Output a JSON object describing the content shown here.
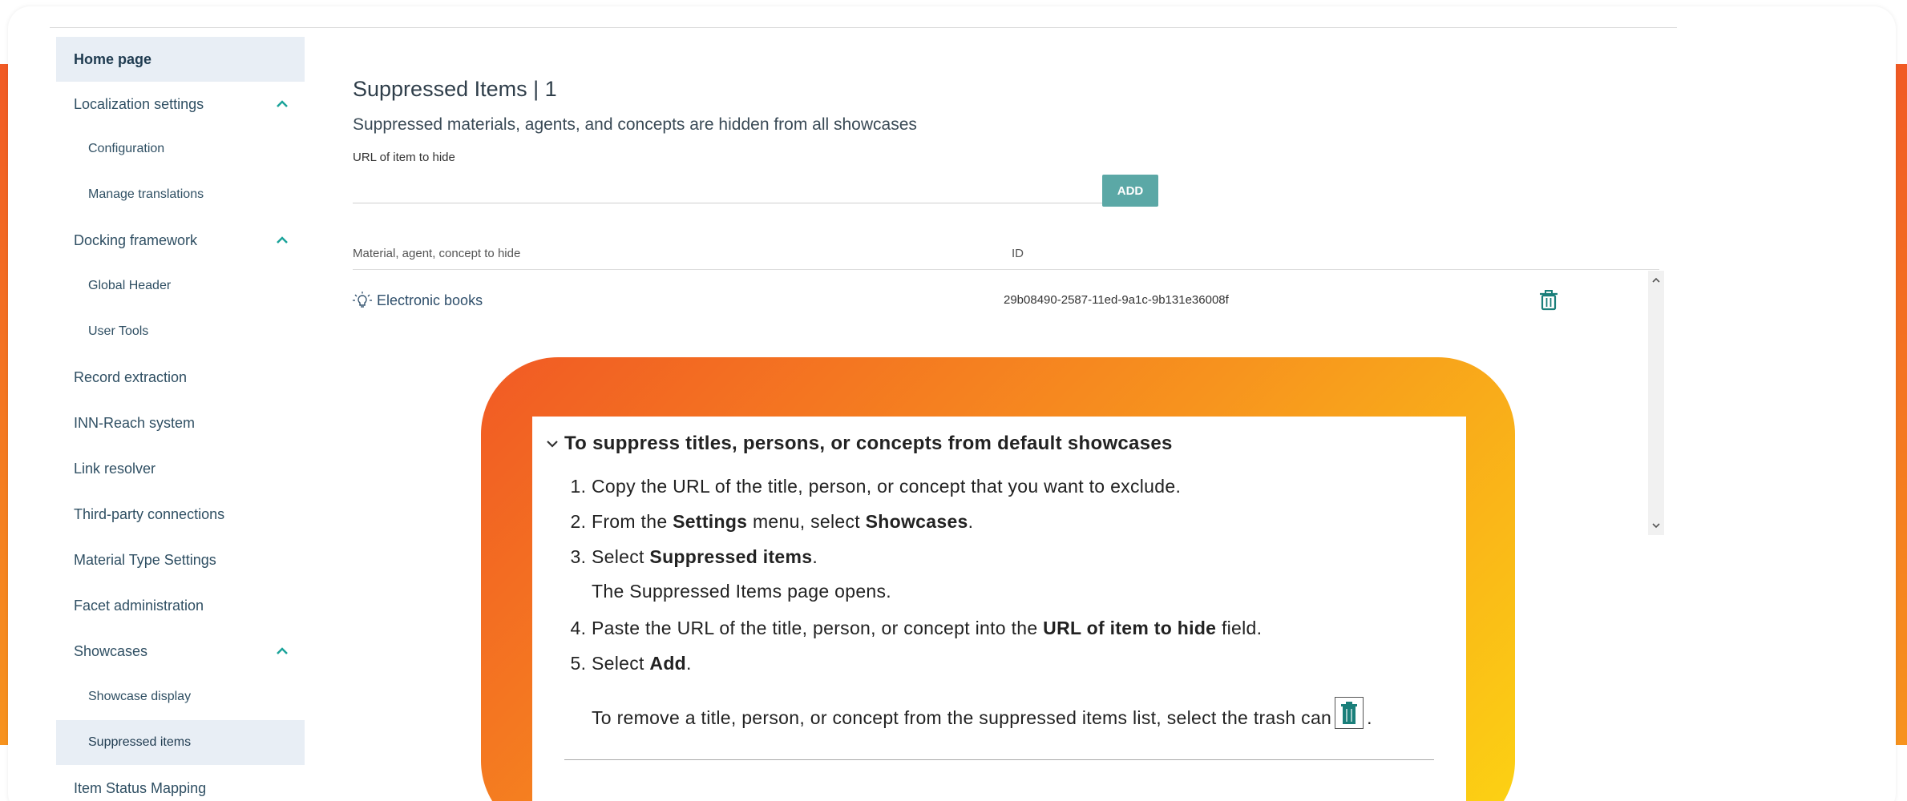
{
  "sidebar": {
    "items": [
      {
        "label": "Home page"
      },
      {
        "label": "Localization settings"
      },
      {
        "label": "Configuration"
      },
      {
        "label": "Manage translations"
      },
      {
        "label": "Docking framework"
      },
      {
        "label": "Global Header"
      },
      {
        "label": "User Tools"
      },
      {
        "label": "Record extraction"
      },
      {
        "label": "INN-Reach system"
      },
      {
        "label": "Link resolver"
      },
      {
        "label": "Third-party connections"
      },
      {
        "label": "Material Type Settings"
      },
      {
        "label": "Facet administration"
      },
      {
        "label": "Showcases"
      },
      {
        "label": "Showcase display"
      },
      {
        "label": "Suppressed items"
      },
      {
        "label": "Item Status Mapping"
      }
    ]
  },
  "main": {
    "title": "Suppressed Items | 1",
    "subtitle": "Suppressed materials, agents, and concepts are hidden from all showcases",
    "url_label": "URL of item to hide",
    "url_value": "",
    "add_label": "ADD",
    "table": {
      "col1": "Material, agent, concept to hide",
      "col2": "ID",
      "rows": [
        {
          "name": "Electronic books",
          "id": "29b08490-2587-11ed-9a1c-9b131e36008f"
        }
      ]
    }
  },
  "callout": {
    "title": "To suppress titles, persons, or concepts from default showcases",
    "step1": "Copy the URL of the title, person, or concept that you want to exclude.",
    "step2_a": "From the ",
    "step2_b": "Settings",
    "step2_c": " menu, select ",
    "step2_d": "Showcases",
    "step2_e": ".",
    "step3_a": "Select ",
    "step3_b": "Suppressed items",
    "step3_c": ".",
    "step3_note": "The Suppressed Items page opens.",
    "step4_a": "Paste the URL of the title, person, or concept into the ",
    "step4_b": "URL of item to hide",
    "step4_c": " field.",
    "step5_a": "Select ",
    "step5_b": "Add",
    "step5_c": ".",
    "remove_note": "To remove a title, person, or concept from the suppressed items list, select the trash can",
    "remove_end": "."
  },
  "colors": {
    "accent": "#5ba8a6",
    "trash": "#1a7f7a",
    "orange": "#f15a24",
    "yellow": "#fcd413"
  }
}
